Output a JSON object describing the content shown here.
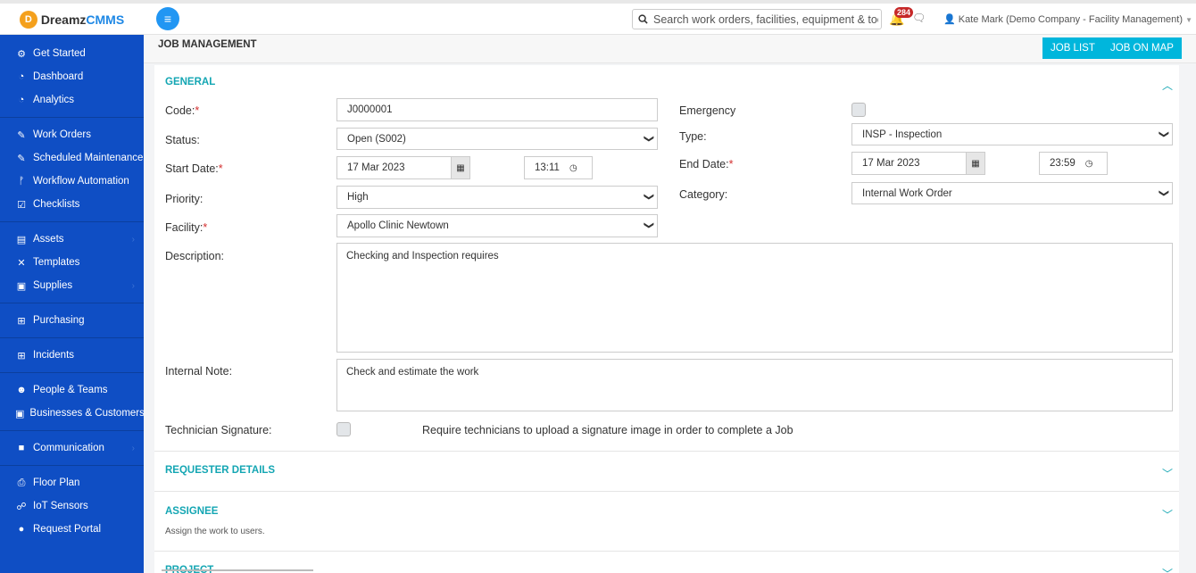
{
  "app": {
    "logo_mark": "D",
    "logo_text_a": "Dreamz",
    "logo_text_b": "CMMS"
  },
  "topbar": {
    "search_placeholder": "Search work orders, facilities, equipment & tools",
    "notifications_count": "284",
    "user_label": "Kate Mark (Demo Company - Facility Management)"
  },
  "sidebar": {
    "items": [
      {
        "label": "Get Started",
        "icon": "gears-icon",
        "glyph": "⚙"
      },
      {
        "label": "Dashboard",
        "icon": "dashboard-icon",
        "glyph": "◔"
      },
      {
        "label": "Analytics",
        "icon": "analytics-icon",
        "glyph": "◔"
      },
      {
        "label": "Work Orders",
        "icon": "wrench-icon",
        "glyph": "✎"
      },
      {
        "label": "Scheduled Maintenance",
        "icon": "wrench-icon",
        "glyph": "✎"
      },
      {
        "label": "Workflow Automation",
        "icon": "branch-icon",
        "glyph": "ᚠ"
      },
      {
        "label": "Checklists",
        "icon": "checkbox-icon",
        "glyph": "☑"
      },
      {
        "label": "Assets",
        "icon": "asset-icon",
        "glyph": "▤"
      },
      {
        "label": "Templates",
        "icon": "shuffle-icon",
        "glyph": "✕"
      },
      {
        "label": "Supplies",
        "icon": "briefcase-icon",
        "glyph": "▣"
      },
      {
        "label": "Purchasing",
        "icon": "cart-icon",
        "glyph": "⊞"
      },
      {
        "label": "Incidents",
        "icon": "cart-icon",
        "glyph": "⊞"
      },
      {
        "label": "People & Teams",
        "icon": "users-icon",
        "glyph": "☻"
      },
      {
        "label": "Businesses & Customers",
        "icon": "briefcase-icon",
        "glyph": "▣"
      },
      {
        "label": "Communication",
        "icon": "video-icon",
        "glyph": "■"
      },
      {
        "label": "Floor Plan",
        "icon": "print-icon",
        "glyph": "⎙"
      },
      {
        "label": "IoT Sensors",
        "icon": "sensor-icon",
        "glyph": "☍"
      },
      {
        "label": "Request Portal",
        "icon": "comment-icon",
        "glyph": "●"
      }
    ]
  },
  "header": {
    "title": "JOB MANAGEMENT",
    "job_list": "JOB LIST",
    "job_on_map": "JOB ON MAP"
  },
  "general": {
    "title": "GENERAL",
    "code_label": "Code:",
    "code_value": "J0000001",
    "status_label": "Status:",
    "status_value": "Open (S002)",
    "start_date_label": "Start Date:",
    "start_date_value": "17 Mar 2023",
    "start_time_value": "13:11",
    "priority_label": "Priority:",
    "priority_value": "High",
    "facility_label": "Facility:",
    "facility_value": "Apollo Clinic Newtown",
    "emergency_label": "Emergency",
    "type_label": "Type:",
    "type_value": "INSP - Inspection",
    "end_date_label": "End Date:",
    "end_date_value": "17 Mar 2023",
    "end_time_value": "23:59",
    "category_label": "Category:",
    "category_value": "Internal Work Order",
    "description_label": "Description:",
    "description_value": "Checking and Inspection requires",
    "internal_note_label": "Internal Note:",
    "internal_note_value": "Check and estimate the work",
    "signature_label": "Technician Signature:",
    "signature_text": "Require technicians to upload a signature image in order to complete a Job",
    "required_mark": "*"
  },
  "requester": {
    "title": "REQUESTER DETAILS"
  },
  "assignee": {
    "title": "ASSIGNEE",
    "subtitle": "Assign the work to users."
  },
  "project": {
    "title": "PROJECT"
  }
}
